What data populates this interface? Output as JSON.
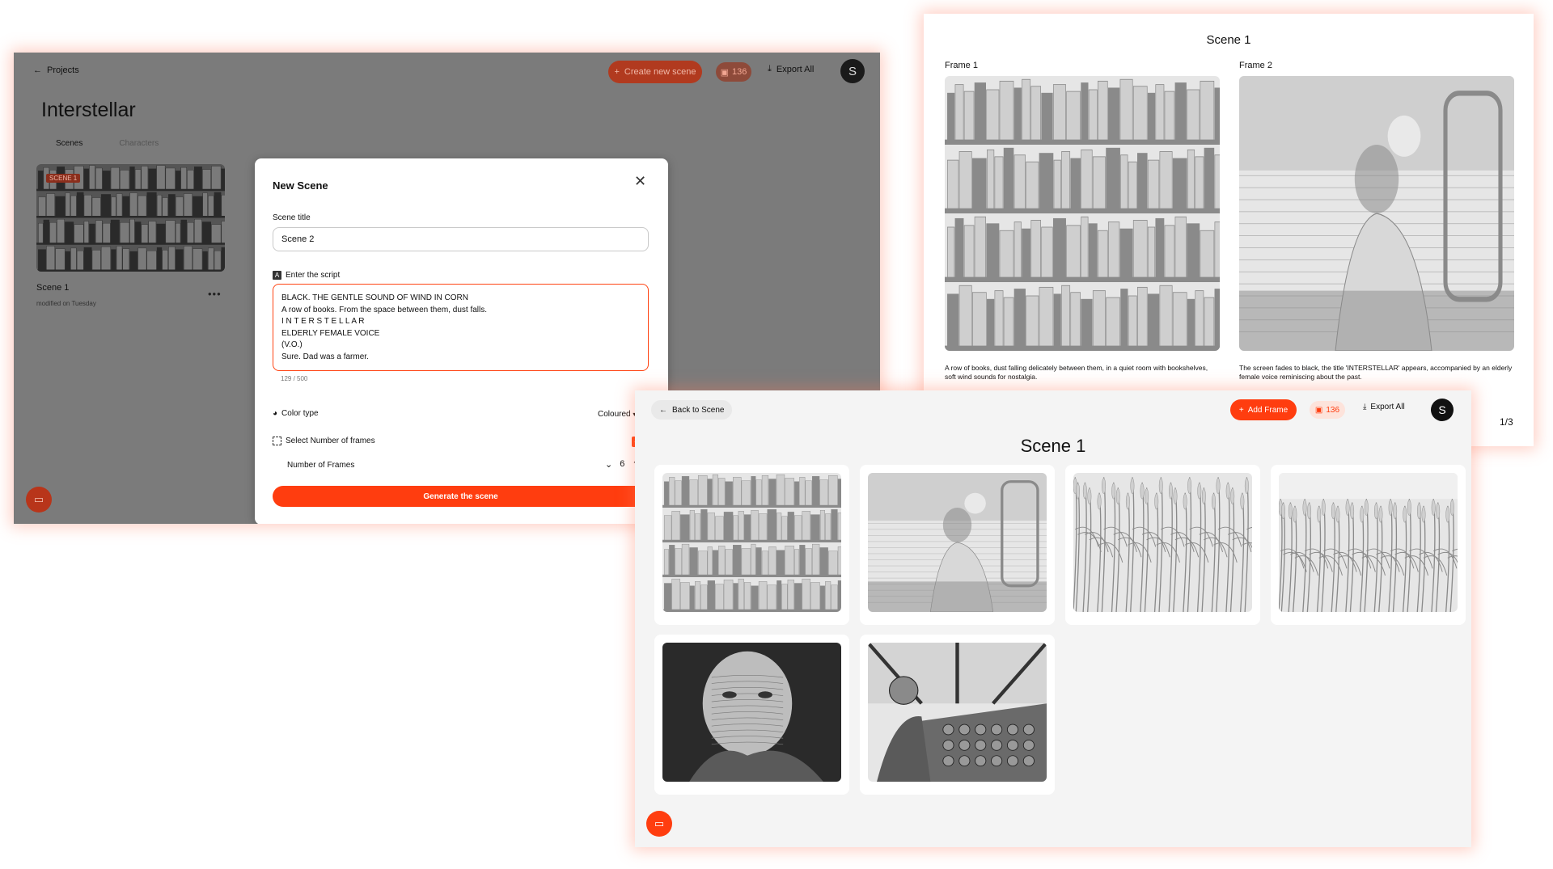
{
  "projects_window": {
    "back_label": "Projects",
    "create_button": "Create new scene",
    "credits": "136",
    "export_label": "Export All",
    "avatar_initial": "S",
    "project_title": "Interstellar",
    "tabs": [
      "Scenes",
      "Characters"
    ],
    "scene_card": {
      "badge": "SCENE 1",
      "name": "Scene 1",
      "modified": "modified on Tuesday",
      "more": "•••"
    }
  },
  "new_scene_modal": {
    "title": "New Scene",
    "scene_title_label": "Scene title",
    "scene_title_value": "Scene 2",
    "script_label": "Enter the script",
    "script_lines": [
      "BLACK. THE GENTLE SOUND OF WIND IN CORN",
      "A row of books. From the space between them, dust falls.",
      "I N T E R S T E L L A R",
      "ELDERLY FEMALE VOICE",
      "(V.O.)",
      "Sure. Dad was a farmer."
    ],
    "char_counter": "129 / 500",
    "color_type_label": "Color type",
    "color_type_value": "Coloured",
    "select_frames_label": "Select Number of frames",
    "select_frames_checked": true,
    "number_frames_label": "Number of Frames",
    "number_frames_value": "6",
    "generate_button": "Generate the scene"
  },
  "frame_viewer": {
    "title": "Scene 1",
    "frames": [
      {
        "label": "Frame 1",
        "description": "A row of books, dust falling delicately between them, in a quiet room with bookshelves, soft wind sounds for nostalgia.",
        "art": "bookshelf"
      },
      {
        "label": "Frame 2",
        "description": "The screen fades to black, the title 'INTERSTELLAR' appears, accompanied by an elderly female voice reminiscing about the past.",
        "art": "woman-sea"
      }
    ],
    "pager": "1/3"
  },
  "scene_grid": {
    "back_label": "Back to Scene",
    "add_frame_label": "Add Frame",
    "credits": "136",
    "export_label": "Export All",
    "avatar_initial": "S",
    "title": "Scene 1",
    "frames": [
      "bookshelf",
      "woman-sea",
      "corn-close",
      "corn-field",
      "elderly-woman",
      "cockpit"
    ]
  },
  "colors": {
    "accent": "#ff3d0f",
    "overlay": "#7b7b7b",
    "panel": "#f4f4f4"
  }
}
